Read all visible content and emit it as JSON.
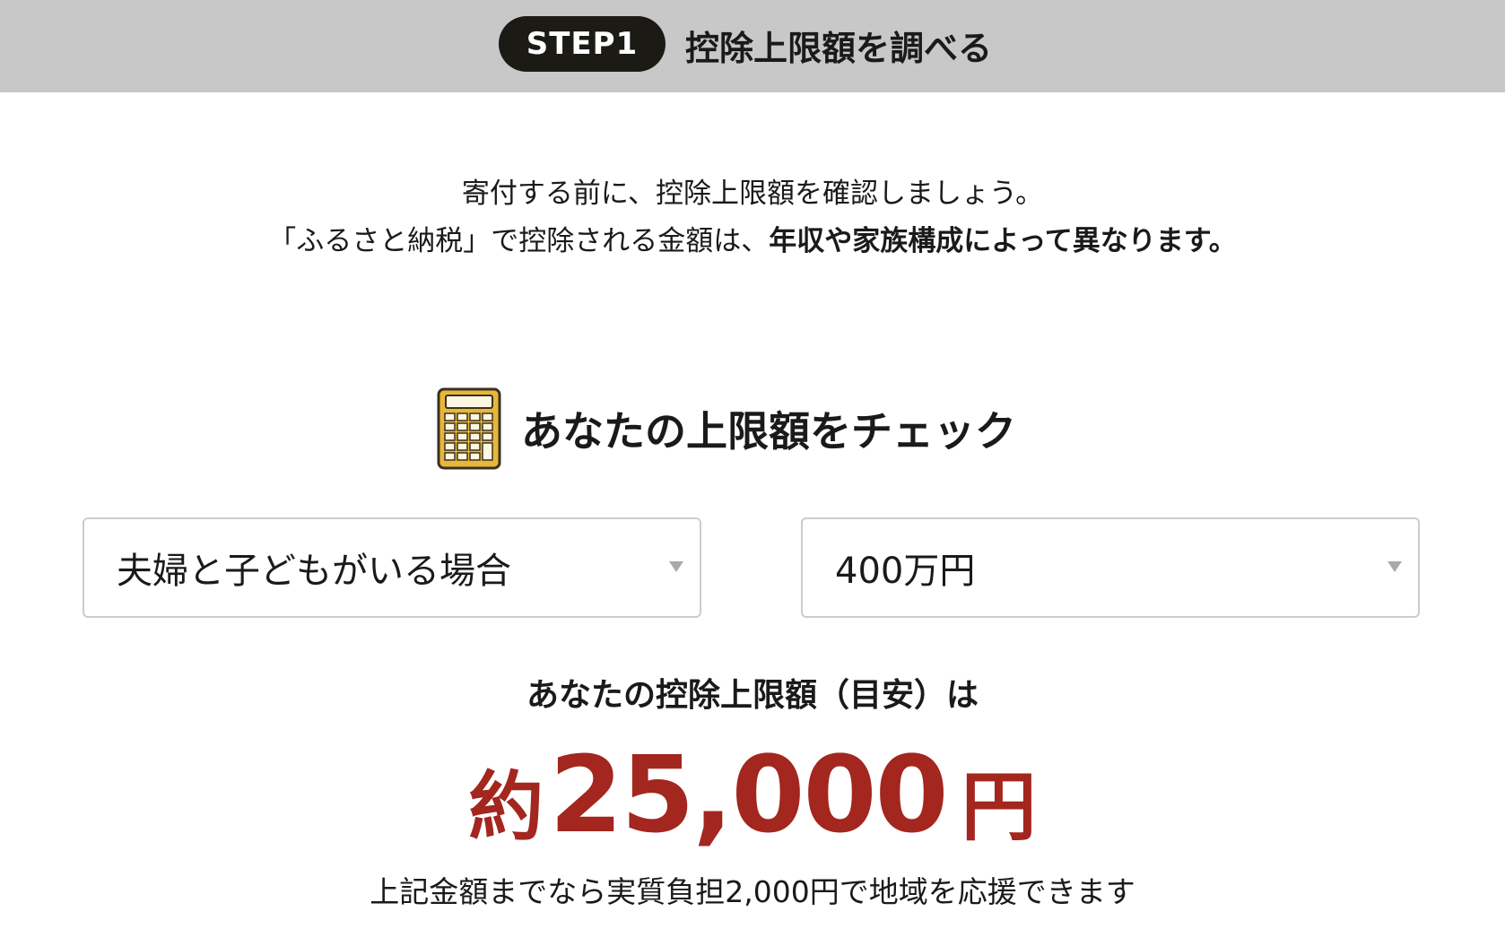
{
  "header": {
    "step_badge": "STEP1",
    "title": "控除上限額を調べる"
  },
  "intro": {
    "line1": "寄付する前に、控除上限額を確認しましょう。",
    "line2_normal": "「ふるさと納税」で控除される金額は、",
    "line2_bold": "年収や家族構成によって異なります。"
  },
  "checker": {
    "icon": "calculator-icon",
    "title": "あなたの上限額をチェック",
    "family_select": {
      "value": "夫婦と子どもがいる場合"
    },
    "income_select": {
      "value": "400万円"
    }
  },
  "result": {
    "label": "あなたの控除上限額（目安）は",
    "prefix": "約",
    "amount": "25,000",
    "unit": "円",
    "note": "上記金額までなら実質負担2,000円で地域を応援できます"
  },
  "colors": {
    "header_bg": "#c8c8c8",
    "badge_bg": "#1c1a15",
    "accent_red": "#a3261f",
    "calculator_gold": "#e8b73a"
  }
}
